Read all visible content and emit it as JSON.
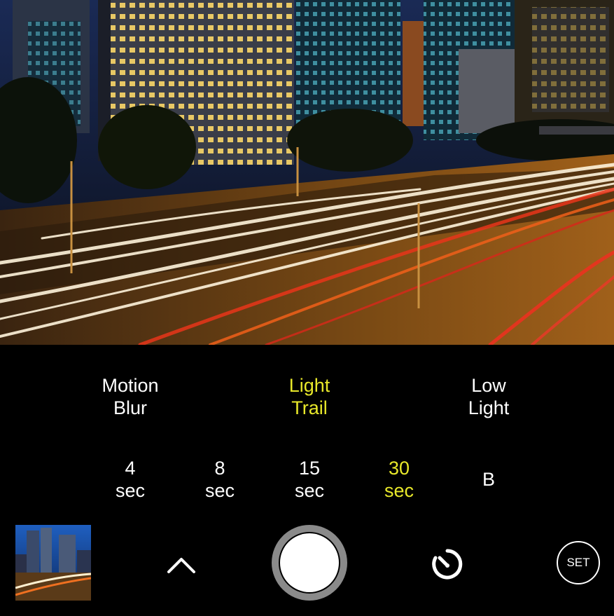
{
  "modes": [
    {
      "line1": "Motion",
      "line2": "Blur",
      "active": false
    },
    {
      "line1": "Light",
      "line2": "Trail",
      "active": true
    },
    {
      "line1": "Low",
      "line2": "Light",
      "active": false
    }
  ],
  "exposures": [
    {
      "value": "4",
      "unit": "sec"
    },
    {
      "value": "8",
      "unit": "sec"
    },
    {
      "value": "15",
      "unit": "sec"
    },
    {
      "value": "30",
      "unit": "sec",
      "active": true
    },
    {
      "value": "B"
    }
  ],
  "controls": {
    "set_label": "SET",
    "chevron_icon": "chevron-up-icon",
    "timer_icon": "self-timer-icon",
    "shutter_icon": "shutter-button"
  },
  "colors": {
    "active": "#e8e82a",
    "inactive": "#ffffff",
    "background": "#000000"
  }
}
